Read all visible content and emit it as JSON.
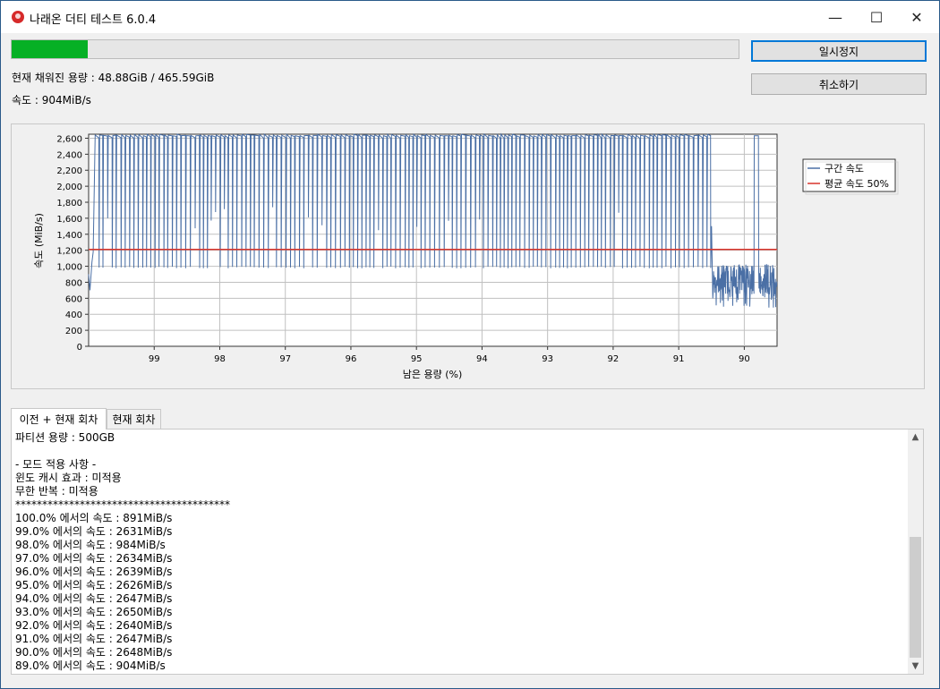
{
  "window": {
    "title": "나래온 더티 테스트 6.0.4"
  },
  "progress": {
    "value_percent": 10.5,
    "color": "#06b025"
  },
  "buttons": {
    "pause": "일시정지",
    "cancel": "취소하기"
  },
  "status": {
    "capacity": "현재 채워진 용량 : 48.88GiB / 465.59GiB",
    "speed": "속도 : 904MiB/s"
  },
  "chart_data": {
    "type": "line",
    "xlabel": "남은 용량 (%)",
    "ylabel": "속도 (MiB/s)",
    "x_reversed": true,
    "xlim": [
      100,
      89.5
    ],
    "ylim": [
      0,
      2600
    ],
    "yticks": [
      0,
      200,
      400,
      600,
      800,
      1000,
      1200,
      1400,
      1600,
      1800,
      2000,
      2200,
      2400,
      2600
    ],
    "ytick_labels": [
      "0",
      "200",
      "400",
      "600",
      "800",
      "1,000",
      "1,200",
      "1,400",
      "1,600",
      "1,800",
      "2,000",
      "2,200",
      "2,400",
      "2,600"
    ],
    "xticks": [
      99,
      98,
      97,
      96,
      95,
      94,
      93,
      92,
      91,
      90
    ],
    "grid": true,
    "legend_position": "top-right",
    "series": [
      {
        "name": "구간 속도",
        "color": "#4a6fa5",
        "pattern": "oscillating between ~980 and ~2640 MiB/s from 100% to 90.5%, then ~600–1000 MiB/s noise down to 89.5% with a spike to ~2640 near 89.8%",
        "x": [
          100.0,
          99.0,
          98.0,
          97.0,
          96.0,
          95.0,
          94.0,
          93.0,
          92.0,
          91.0,
          90.0,
          89.0
        ],
        "y": [
          891,
          2631,
          984,
          2634,
          2639,
          2626,
          2647,
          2650,
          2640,
          2647,
          2648,
          904
        ]
      },
      {
        "name": "평균 속도 50%",
        "color": "#d9342b",
        "constant": 1210
      }
    ]
  },
  "tabs": [
    {
      "label": "이전 + 현재 회차"
    },
    {
      "label": "현재 회차"
    }
  ],
  "log": [
    "파티션 용량 : 500GB",
    "",
    "- 모드 적용 사항 -",
    "윈도 캐시 효과 : 미적용",
    "무한 반복 : 미적용",
    "****************************************",
    "100.0% 에서의 속도 : 891MiB/s",
    "99.0% 에서의 속도 : 2631MiB/s",
    "98.0% 에서의 속도 : 984MiB/s",
    "97.0% 에서의 속도 : 2634MiB/s",
    "96.0% 에서의 속도 : 2639MiB/s",
    "95.0% 에서의 속도 : 2626MiB/s",
    "94.0% 에서의 속도 : 2647MiB/s",
    "93.0% 에서의 속도 : 2650MiB/s",
    "92.0% 에서의 속도 : 2640MiB/s",
    "91.0% 에서의 속도 : 2647MiB/s",
    "90.0% 에서의 속도 : 2648MiB/s",
    "89.0% 에서의 속도 : 904MiB/s"
  ]
}
